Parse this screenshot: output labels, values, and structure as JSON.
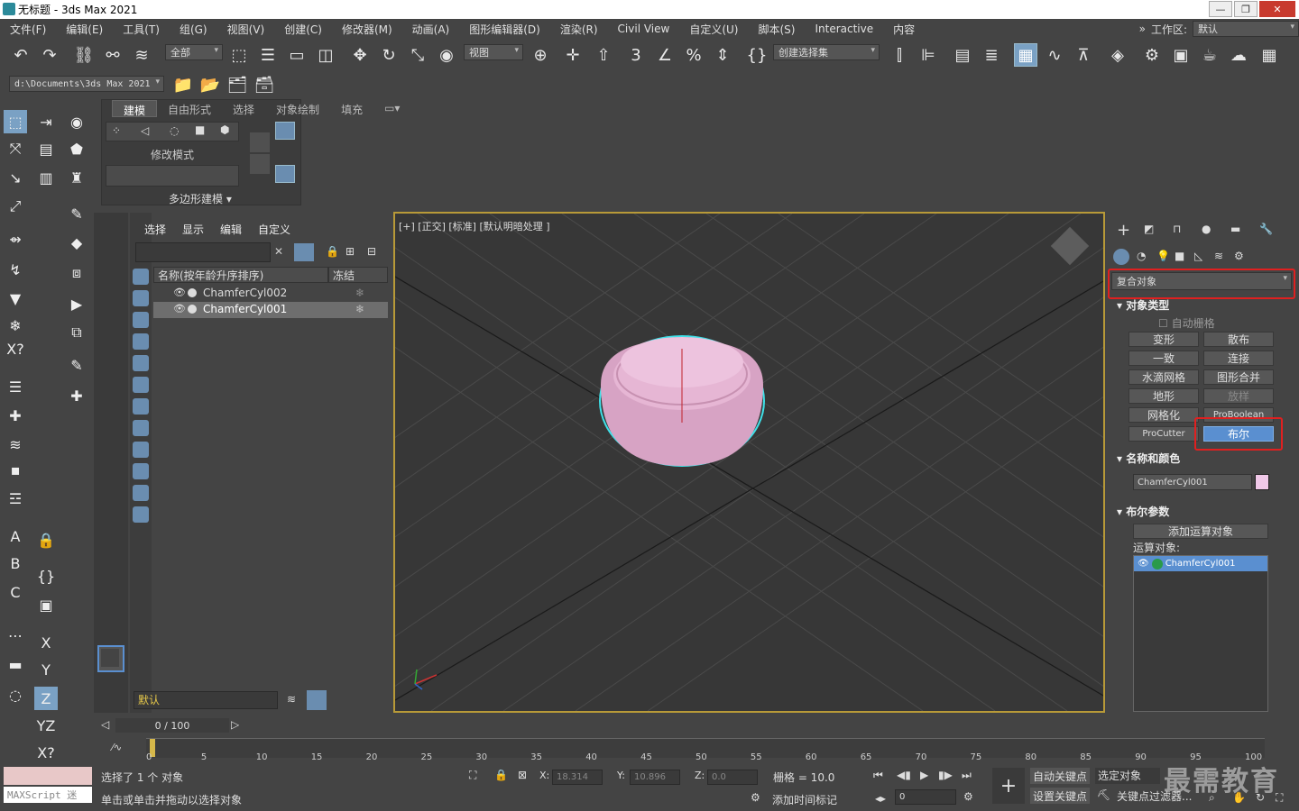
{
  "title": "无标题 - 3ds Max 2021",
  "menu": [
    "文件(F)",
    "编辑(E)",
    "工具(T)",
    "组(G)",
    "视图(V)",
    "创建(C)",
    "修改器(M)",
    "动画(A)",
    "图形编辑器(D)",
    "渲染(R)",
    "Civil View",
    "自定义(U)",
    "脚本(S)",
    "Interactive",
    "内容"
  ],
  "workspace": {
    "label": "工作区:",
    "value": "默认"
  },
  "toolbar": {
    "filter": "全部",
    "refcoord": "视图",
    "selset": "创建选择集"
  },
  "path": "d:\\Documents\\3ds Max 2021",
  "ribbon": {
    "tabs": [
      "建模",
      "自由形式",
      "选择",
      "对象绘制",
      "填充"
    ],
    "mode": "修改模式",
    "poly": "多边形建模 ▾"
  },
  "explorer": {
    "menu": [
      "选择",
      "显示",
      "编辑",
      "自定义"
    ],
    "col_name": "名称(按年龄升序排序)",
    "col_freeze": "冻结",
    "rows": [
      "ChamferCyl002",
      "ChamferCyl001"
    ],
    "layer": "默认"
  },
  "viewport": {
    "label": "[+] [正交] [标准] [默认明暗处理 ]"
  },
  "panel": {
    "dropdown": "复合对象",
    "rollout_type": "对象类型",
    "autogrid": "自动栅格",
    "buttons": [
      "变形",
      "散布",
      "一致",
      "连接",
      "水滴网格",
      "图形合并",
      "地形",
      "放样",
      "网格化",
      "ProBoolean",
      "ProCutter",
      "布尔"
    ],
    "rollout_name": "名称和颜色",
    "obj_name": "ChamferCyl001",
    "obj_color": "#f0c8e8",
    "rollout_bool": "布尔参数",
    "add_operand": "添加运算对象",
    "operand_label": "运算对象:",
    "operand": "ChamferCyl001"
  },
  "timeline": {
    "frame": "0 / 100",
    "ticks": [
      "0",
      "5",
      "10",
      "15",
      "20",
      "25",
      "30",
      "35",
      "40",
      "45",
      "50",
      "55",
      "60",
      "65",
      "70",
      "75",
      "80",
      "85",
      "90",
      "95",
      "100"
    ]
  },
  "status": {
    "maxscript": "MAXScript 迷",
    "selected": "选择了 1 个 对象",
    "hint": "单击或单击并拖动以选择对象",
    "x": "18.314",
    "y": "10.896",
    "z": "0.0",
    "grid": "栅格 = 10.0",
    "addtime": "添加时间标记",
    "autokey": "自动关键点",
    "selobj": "选定对象",
    "setkey": "设置关键点",
    "keyfilter": "关键点过滤器...",
    "spin": "0",
    "watermark": "最需教育"
  }
}
